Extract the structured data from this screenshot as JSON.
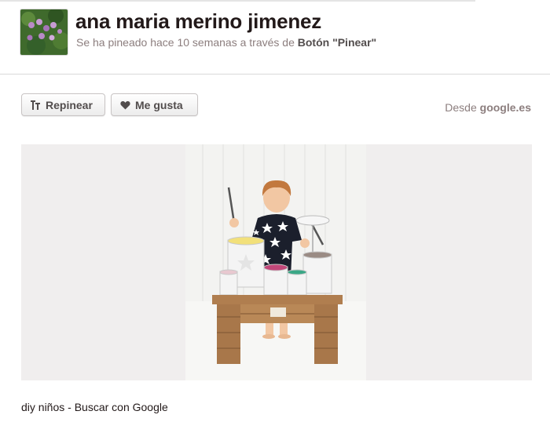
{
  "pinner": {
    "name": "ana maria merino jimenez",
    "pinned_text": "Se ha pineado hace 10 semanas a través de",
    "pinned_via": "Botón \"Pinear\""
  },
  "actions": {
    "repin_label": "Repinear",
    "like_label": "Me gusta"
  },
  "source": {
    "prefix": "Desde",
    "domain": "google.es"
  },
  "pin": {
    "caption": "diy niños - Buscar con Google"
  },
  "icons": {
    "repin": "pushpin-icon",
    "like": "heart-icon"
  },
  "colors": {
    "name": "#221919",
    "meta": "#8c7e7e",
    "button_text": "#524d4d",
    "image_background": "#f0eeee"
  }
}
